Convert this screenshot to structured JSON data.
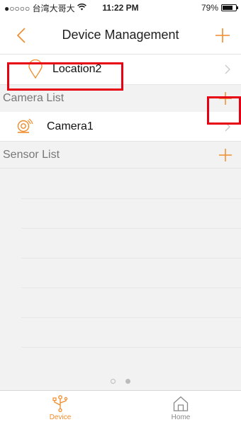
{
  "status_bar": {
    "carrier": "●○○○○ 台湾大哥大",
    "wifi_icon": "wifi-icon",
    "time": "11:22 PM",
    "battery_percent": "79%",
    "battery_level": 0.79
  },
  "nav": {
    "title": "Device Management",
    "back_icon": "chevron-left-icon",
    "add_icon": "plus-icon",
    "accent_color": "#f08c2a"
  },
  "location": {
    "label": "Location2",
    "icon": "map-pin-icon"
  },
  "camera_section": {
    "label": "Camera List",
    "items": [
      {
        "label": "Camera1",
        "icon": "camera-icon"
      }
    ]
  },
  "sensor_section": {
    "label": "Sensor List"
  },
  "pager": {
    "pages": 2,
    "current": 2
  },
  "tabbar": {
    "tabs": [
      {
        "label": "Device",
        "icon": "usb-device-icon",
        "active": true
      },
      {
        "label": "Home",
        "icon": "home-icon",
        "active": false
      }
    ]
  },
  "colors": {
    "highlight": "#e60012",
    "background": "#f2f2f2"
  }
}
